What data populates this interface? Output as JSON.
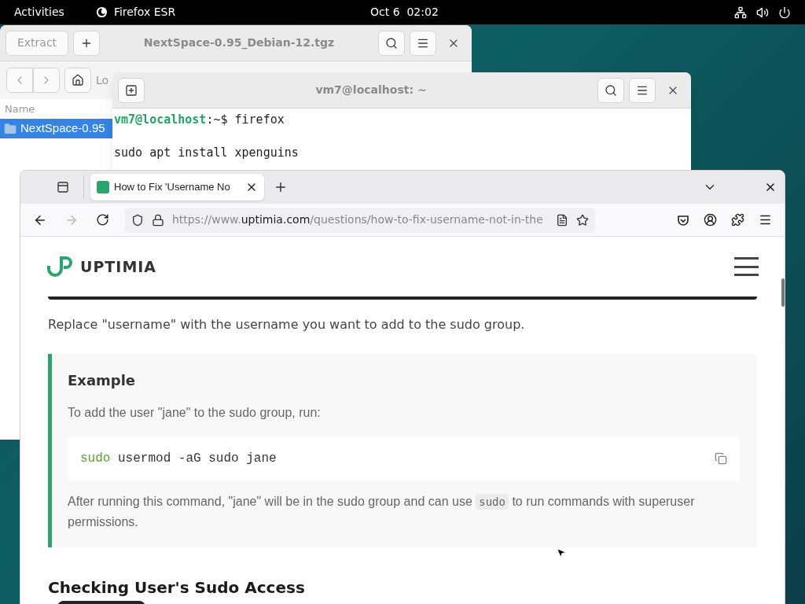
{
  "top_bar": {
    "activities": "Activities",
    "app_name": "Firefox ESR",
    "clock": "Oct 6  02:02"
  },
  "archive_window": {
    "extract_button": "Extract",
    "title": "NextSpace-0.95_Debian-12.tgz",
    "location_label": "Lo",
    "column": "Name",
    "items": [
      {
        "name": "NextSpace-0.95",
        "selected": true
      }
    ]
  },
  "terminal_window": {
    "title": "vm7@localhost: ~",
    "lines": [
      {
        "kind": "prompt",
        "prompt_user": "vm7@localhost",
        "prompt_rest": ":~$ ",
        "text": "firefox"
      },
      {
        "kind": "blank"
      },
      {
        "kind": "output",
        "text": "sudo apt install xpenguins"
      }
    ]
  },
  "browser": {
    "tabs": [
      {
        "title": "How to Fix 'Username No",
        "selected": true
      }
    ],
    "back_disabled": false,
    "forward_disabled": true,
    "url": {
      "prefix": "https://www.",
      "domain": "uptimia.com",
      "path": "/questions/how-to-fix-username-not-in-the"
    },
    "page": {
      "logo": "UPTIMIA",
      "intro": "Replace \"username\" with the username you want to add to the sudo group.",
      "example": {
        "title": "Example",
        "text": "To add the user \"jane\" to the sudo group, run:",
        "code": {
          "command": "sudo",
          "args": "usermod -aG sudo jane"
        },
        "after_before": "After running this command, \"jane\" will be in the sudo group and can use ",
        "after_code": "sudo",
        "after_rest": " to run commands with superuser permissions."
      },
      "heading": "Checking User's Sudo Access"
    }
  }
}
